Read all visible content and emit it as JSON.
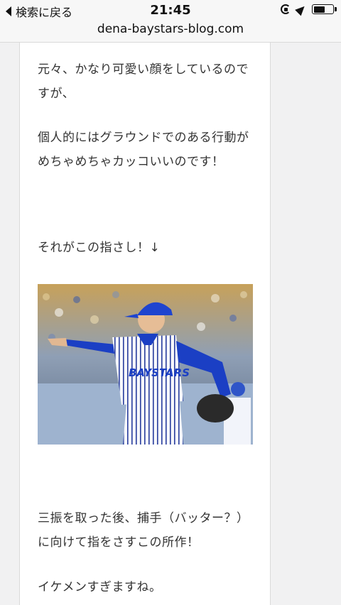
{
  "status_bar": {
    "back_label": "検索に戻る",
    "time": "21:45",
    "battery_level": 0.6
  },
  "browser": {
    "url": "dena-baystars-blog.com"
  },
  "article": {
    "paragraphs": [
      "元々、かなり可愛い顔をしているのですが、",
      "個人的にはグラウンドでのある行動がめちゃめちゃカッコいいのです！",
      "それがこの指さし！↓",
      "三振を取った後、捕手（バッター？）に向けて指をさすこの所作！",
      "イケメンすぎますね。"
    ],
    "photo": {
      "jersey_text": "BAYSTARS",
      "uniform_color": "#1b3fc4",
      "stripe_color": "#2a3f9e"
    }
  },
  "icons": {
    "back": "chevron-left-icon",
    "rotation_lock": "rotation-lock-icon",
    "location": "location-arrow-icon",
    "battery": "battery-icon"
  }
}
